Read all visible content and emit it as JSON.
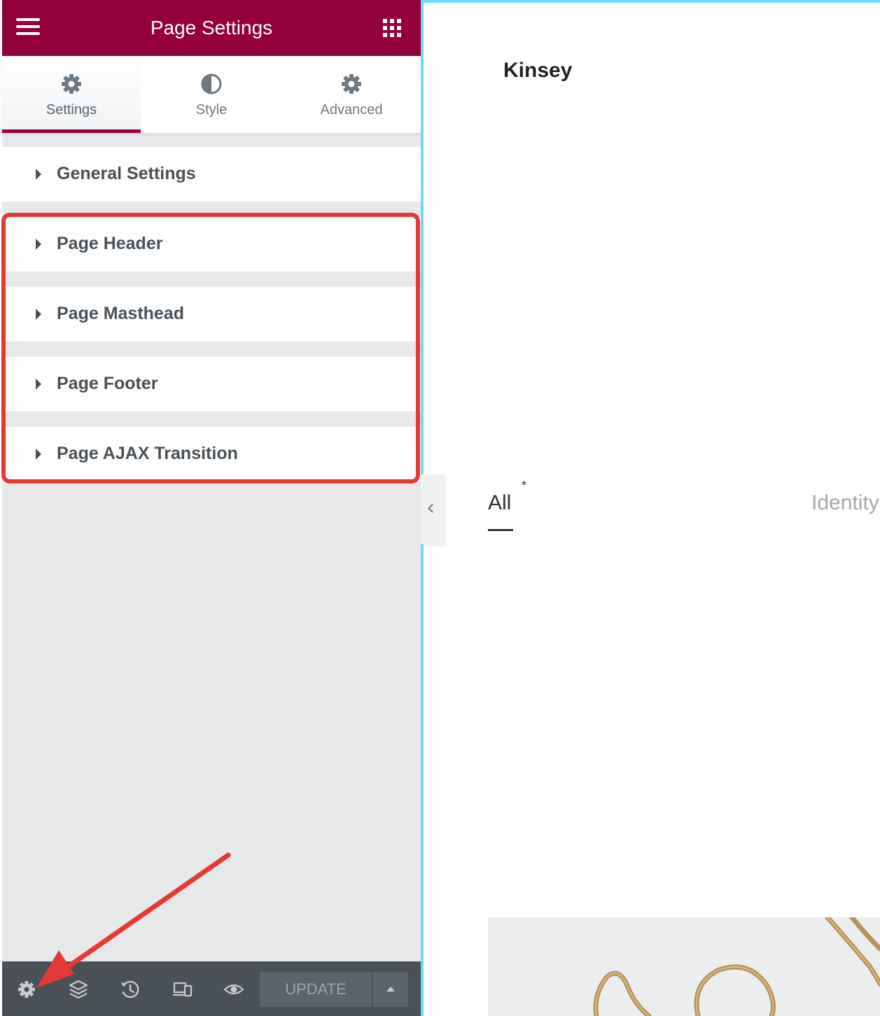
{
  "panel": {
    "title": "Page Settings",
    "tabs": [
      {
        "label": "Settings",
        "icon": "gear-icon",
        "active": true
      },
      {
        "label": "Style",
        "icon": "contrast-icon",
        "active": false
      },
      {
        "label": "Advanced",
        "icon": "gear-icon",
        "active": false
      }
    ],
    "sections": [
      {
        "label": "General Settings"
      },
      {
        "label": "Page Header"
      },
      {
        "label": "Page Masthead"
      },
      {
        "label": "Page Footer"
      },
      {
        "label": "Page AJAX Transition"
      }
    ],
    "footer": {
      "icons": [
        "gear-icon",
        "layers-icon",
        "history-icon",
        "responsive-icon",
        "eye-icon"
      ],
      "update_label": "UPDATE"
    }
  },
  "preview": {
    "site_title": "Kinsey",
    "filters": {
      "all": "All",
      "all_marker": "*",
      "identity": "Identity"
    }
  },
  "colors": {
    "brand": "#93003a",
    "annotation": "#e53935",
    "preview_border": "#71d7f7"
  }
}
